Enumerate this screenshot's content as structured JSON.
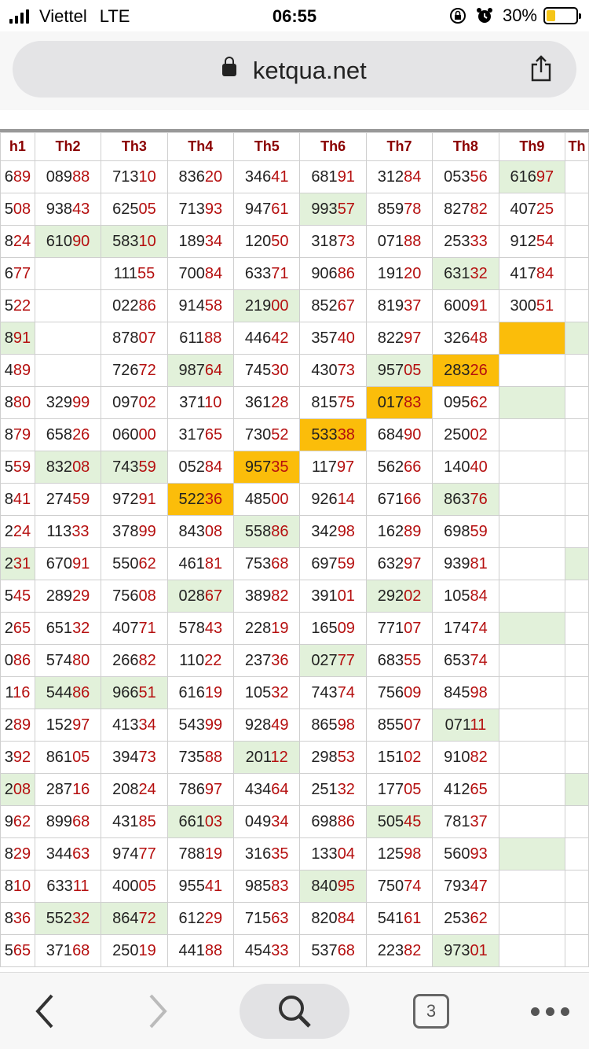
{
  "status": {
    "carrier": "Viettel",
    "network": "LTE",
    "time": "06:55",
    "battery": "30%",
    "battery_level": 0.3
  },
  "browser": {
    "url": "ketqua.net",
    "tab_count": "3"
  },
  "colors": {
    "header_red": "#8b0000",
    "digit_red": "#b50f0f",
    "green_cell": "#e2f1da",
    "orange_cell": "#fbbd0a"
  },
  "table": {
    "headers": [
      "h1",
      "Th2",
      "Th3",
      "Th4",
      "Th5",
      "Th6",
      "Th7",
      "Th8",
      "Th9",
      "Th"
    ],
    "rows": [
      [
        [
          "689",
          ""
        ],
        [
          "08988",
          ""
        ],
        [
          "71310",
          ""
        ],
        [
          "83620",
          ""
        ],
        [
          "34641",
          ""
        ],
        [
          "68191",
          ""
        ],
        [
          "31284",
          ""
        ],
        [
          "05356",
          ""
        ],
        [
          "61697",
          "g"
        ],
        [
          "",
          ""
        ]
      ],
      [
        [
          "508",
          ""
        ],
        [
          "93843",
          ""
        ],
        [
          "62505",
          ""
        ],
        [
          "71393",
          ""
        ],
        [
          "94761",
          ""
        ],
        [
          "99357",
          "g"
        ],
        [
          "85978",
          ""
        ],
        [
          "82782",
          ""
        ],
        [
          "40725",
          ""
        ],
        [
          "",
          ""
        ]
      ],
      [
        [
          "824",
          ""
        ],
        [
          "61090",
          "g"
        ],
        [
          "58310",
          "g"
        ],
        [
          "18934",
          ""
        ],
        [
          "12050",
          ""
        ],
        [
          "31873",
          ""
        ],
        [
          "07188",
          ""
        ],
        [
          "25333",
          ""
        ],
        [
          "91254",
          ""
        ],
        [
          "",
          ""
        ]
      ],
      [
        [
          "677",
          ""
        ],
        [
          "",
          ""
        ],
        [
          "11155",
          ""
        ],
        [
          "70084",
          ""
        ],
        [
          "63371",
          ""
        ],
        [
          "90686",
          ""
        ],
        [
          "19120",
          ""
        ],
        [
          "63132",
          "g"
        ],
        [
          "41784",
          ""
        ],
        [
          "",
          ""
        ]
      ],
      [
        [
          "522",
          ""
        ],
        [
          "",
          ""
        ],
        [
          "02286",
          ""
        ],
        [
          "91458",
          ""
        ],
        [
          "21900",
          "g"
        ],
        [
          "85267",
          ""
        ],
        [
          "81937",
          ""
        ],
        [
          "60091",
          ""
        ],
        [
          "30051",
          ""
        ],
        [
          "",
          ""
        ]
      ],
      [
        [
          "891",
          "g"
        ],
        [
          "",
          ""
        ],
        [
          "87807",
          ""
        ],
        [
          "61188",
          ""
        ],
        [
          "44642",
          ""
        ],
        [
          "35740",
          ""
        ],
        [
          "82297",
          ""
        ],
        [
          "32648",
          ""
        ],
        [
          "",
          "o"
        ],
        [
          "",
          "g"
        ]
      ],
      [
        [
          "489",
          ""
        ],
        [
          "",
          ""
        ],
        [
          "72672",
          ""
        ],
        [
          "98764",
          "g"
        ],
        [
          "74530",
          ""
        ],
        [
          "43073",
          ""
        ],
        [
          "95705",
          "g"
        ],
        [
          "28326",
          "o"
        ],
        [
          "",
          ""
        ],
        [
          "",
          ""
        ]
      ],
      [
        [
          "880",
          ""
        ],
        [
          "32999",
          ""
        ],
        [
          "09702",
          ""
        ],
        [
          "37110",
          ""
        ],
        [
          "36128",
          ""
        ],
        [
          "81575",
          ""
        ],
        [
          "01783",
          "o"
        ],
        [
          "09562",
          ""
        ],
        [
          "",
          "g"
        ],
        [
          "",
          ""
        ]
      ],
      [
        [
          "879",
          ""
        ],
        [
          "65826",
          ""
        ],
        [
          "06000",
          ""
        ],
        [
          "31765",
          ""
        ],
        [
          "73052",
          ""
        ],
        [
          "53338",
          "o"
        ],
        [
          "68490",
          ""
        ],
        [
          "25002",
          ""
        ],
        [
          "",
          ""
        ],
        [
          "",
          ""
        ]
      ],
      [
        [
          "559",
          ""
        ],
        [
          "83208",
          "g"
        ],
        [
          "74359",
          "g"
        ],
        [
          "05284",
          ""
        ],
        [
          "95735",
          "o"
        ],
        [
          "11797",
          ""
        ],
        [
          "56266",
          ""
        ],
        [
          "14040",
          ""
        ],
        [
          "",
          ""
        ],
        [
          "",
          ""
        ]
      ],
      [
        [
          "841",
          ""
        ],
        [
          "27459",
          ""
        ],
        [
          "97291",
          ""
        ],
        [
          "52236",
          "o"
        ],
        [
          "48500",
          ""
        ],
        [
          "92614",
          ""
        ],
        [
          "67166",
          ""
        ],
        [
          "86376",
          "g"
        ],
        [
          "",
          ""
        ],
        [
          "",
          ""
        ]
      ],
      [
        [
          "224",
          ""
        ],
        [
          "11333",
          ""
        ],
        [
          "37899",
          ""
        ],
        [
          "84308",
          ""
        ],
        [
          "55886",
          "g"
        ],
        [
          "34298",
          ""
        ],
        [
          "16289",
          ""
        ],
        [
          "69859",
          ""
        ],
        [
          "",
          ""
        ],
        [
          "",
          ""
        ]
      ],
      [
        [
          "231",
          "g"
        ],
        [
          "67091",
          ""
        ],
        [
          "55062",
          ""
        ],
        [
          "46181",
          ""
        ],
        [
          "75368",
          ""
        ],
        [
          "69759",
          ""
        ],
        [
          "63297",
          ""
        ],
        [
          "93981",
          ""
        ],
        [
          "",
          ""
        ],
        [
          "",
          "g"
        ]
      ],
      [
        [
          "545",
          ""
        ],
        [
          "28929",
          ""
        ],
        [
          "75608",
          ""
        ],
        [
          "02867",
          "g"
        ],
        [
          "38982",
          ""
        ],
        [
          "39101",
          ""
        ],
        [
          "29202",
          "g"
        ],
        [
          "10584",
          ""
        ],
        [
          "",
          ""
        ],
        [
          "",
          ""
        ]
      ],
      [
        [
          "265",
          ""
        ],
        [
          "65132",
          ""
        ],
        [
          "40771",
          ""
        ],
        [
          "57843",
          ""
        ],
        [
          "22819",
          ""
        ],
        [
          "16509",
          ""
        ],
        [
          "77107",
          ""
        ],
        [
          "17474",
          ""
        ],
        [
          "",
          "g"
        ],
        [
          "",
          ""
        ]
      ],
      [
        [
          "086",
          ""
        ],
        [
          "57480",
          ""
        ],
        [
          "26682",
          ""
        ],
        [
          "11022",
          ""
        ],
        [
          "23736",
          ""
        ],
        [
          "02777",
          "g"
        ],
        [
          "68355",
          ""
        ],
        [
          "65374",
          ""
        ],
        [
          "",
          ""
        ],
        [
          "",
          ""
        ]
      ],
      [
        [
          "116",
          ""
        ],
        [
          "54486",
          "g"
        ],
        [
          "96651",
          "g"
        ],
        [
          "61619",
          ""
        ],
        [
          "10532",
          ""
        ],
        [
          "74374",
          ""
        ],
        [
          "75609",
          ""
        ],
        [
          "84598",
          ""
        ],
        [
          "",
          ""
        ],
        [
          "",
          ""
        ]
      ],
      [
        [
          "289",
          ""
        ],
        [
          "15297",
          ""
        ],
        [
          "41334",
          ""
        ],
        [
          "54399",
          ""
        ],
        [
          "92849",
          ""
        ],
        [
          "86598",
          ""
        ],
        [
          "85507",
          ""
        ],
        [
          "07111",
          "g"
        ],
        [
          "",
          ""
        ],
        [
          "",
          ""
        ]
      ],
      [
        [
          "392",
          ""
        ],
        [
          "86105",
          ""
        ],
        [
          "39473",
          ""
        ],
        [
          "73588",
          ""
        ],
        [
          "20112",
          "g"
        ],
        [
          "29853",
          ""
        ],
        [
          "15102",
          ""
        ],
        [
          "91082",
          ""
        ],
        [
          "",
          ""
        ],
        [
          "",
          ""
        ]
      ],
      [
        [
          "208",
          "g"
        ],
        [
          "28716",
          ""
        ],
        [
          "20824",
          ""
        ],
        [
          "78697",
          ""
        ],
        [
          "43464",
          ""
        ],
        [
          "25132",
          ""
        ],
        [
          "17705",
          ""
        ],
        [
          "41265",
          ""
        ],
        [
          "",
          ""
        ],
        [
          "",
          "g"
        ]
      ],
      [
        [
          "962",
          ""
        ],
        [
          "89968",
          ""
        ],
        [
          "43185",
          ""
        ],
        [
          "66103",
          "g"
        ],
        [
          "04934",
          ""
        ],
        [
          "69886",
          ""
        ],
        [
          "50545",
          "g"
        ],
        [
          "78137",
          ""
        ],
        [
          "",
          ""
        ],
        [
          "",
          ""
        ]
      ],
      [
        [
          "829",
          ""
        ],
        [
          "34463",
          ""
        ],
        [
          "97477",
          ""
        ],
        [
          "78819",
          ""
        ],
        [
          "31635",
          ""
        ],
        [
          "13304",
          ""
        ],
        [
          "12598",
          ""
        ],
        [
          "56093",
          ""
        ],
        [
          "",
          "g"
        ],
        [
          "",
          ""
        ]
      ],
      [
        [
          "810",
          ""
        ],
        [
          "63311",
          ""
        ],
        [
          "40005",
          ""
        ],
        [
          "95541",
          ""
        ],
        [
          "98583",
          ""
        ],
        [
          "84095",
          "g"
        ],
        [
          "75074",
          ""
        ],
        [
          "79347",
          ""
        ],
        [
          "",
          ""
        ],
        [
          "",
          ""
        ]
      ],
      [
        [
          "836",
          ""
        ],
        [
          "55232",
          "g"
        ],
        [
          "86472",
          "g"
        ],
        [
          "61229",
          ""
        ],
        [
          "71563",
          ""
        ],
        [
          "82084",
          ""
        ],
        [
          "54161",
          ""
        ],
        [
          "25362",
          ""
        ],
        [
          "",
          ""
        ],
        [
          "",
          ""
        ]
      ],
      [
        [
          "565",
          ""
        ],
        [
          "37168",
          ""
        ],
        [
          "25019",
          ""
        ],
        [
          "44188",
          ""
        ],
        [
          "45433",
          ""
        ],
        [
          "53768",
          ""
        ],
        [
          "22382",
          ""
        ],
        [
          "97301",
          "g"
        ],
        [
          "",
          ""
        ],
        [
          "",
          ""
        ]
      ]
    ]
  }
}
